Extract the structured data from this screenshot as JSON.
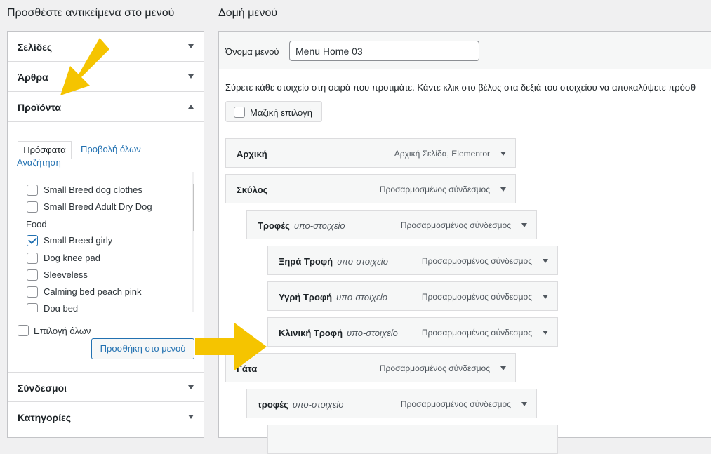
{
  "left": {
    "heading": "Προσθέστε αντικείμενα στο μενού",
    "sections_top": [
      {
        "label": "Σελίδες"
      },
      {
        "label": "Άρθρα"
      },
      {
        "label": "Προϊόντα"
      }
    ],
    "products": {
      "tabs": {
        "recent": "Πρόσφατα",
        "view_all": "Προβολή όλων",
        "search": "Αναζήτηση"
      },
      "items": [
        {
          "label": "Small Breed dog clothes",
          "checked": false
        },
        {
          "label": "Small Breed Adult Dry Dog",
          "checked": false
        },
        {
          "label": "Food",
          "continuation": true
        },
        {
          "label": "Small Breed girly",
          "checked": true
        },
        {
          "label": "Dog knee pad",
          "checked": false
        },
        {
          "label": "Sleeveless",
          "checked": false
        },
        {
          "label": "Calming bed peach pink",
          "checked": false
        },
        {
          "label": "Dog bed",
          "checked": false
        }
      ],
      "select_all": "Επιλογή όλων",
      "add_button": "Προσθήκη στο μενού"
    },
    "sections_bottom": [
      {
        "label": "Σύνδεσμοι"
      },
      {
        "label": "Κατηγορίες"
      }
    ]
  },
  "right": {
    "heading": "Δομή μενού",
    "menu_name_label": "Όνομα μενού",
    "menu_name_value": "Menu Home 03",
    "instructions": "Σύρετε κάθε στοιχείο στη σειρά που προτιμάτε. Κάντε κλικ στο βέλος στα δεξιά του στοιχείου να αποκαλύψετε πρόσθ",
    "bulk_select": "Μαζική επιλογή",
    "menu_items": [
      {
        "title": "Αρχική",
        "sub": "",
        "kind": "Αρχική Σελίδα, Elementor"
      },
      {
        "title": "Σκύλος",
        "sub": "",
        "kind": "Προσαρμοσμένος σύνδεσμος"
      },
      {
        "title": "Τροφές",
        "sub": "υπο-στοιχείο",
        "kind": "Προσαρμοσμένος σύνδεσμος"
      },
      {
        "title": "Ξηρά Τροφή",
        "sub": "υπο-στοιχείο",
        "kind": "Προσαρμοσμένος σύνδεσμος"
      },
      {
        "title": "Υγρή Τροφή",
        "sub": "υπο-στοιχείο",
        "kind": "Προσαρμοσμένος σύνδεσμος"
      },
      {
        "title": "Κλινική Τροφή",
        "sub": "υπο-στοιχείο",
        "kind": "Προσαρμοσμένος σύνδεσμος"
      },
      {
        "title": "Γάτα",
        "sub": "",
        "kind": "Προσαρμοσμένος σύνδεσμος"
      },
      {
        "title": "τροφές",
        "sub": "υπο-στοιχείο",
        "kind": "Προσαρμοσμένος σύνδεσμος"
      }
    ]
  },
  "colors": {
    "accent": "#2271b1",
    "annotation_arrow": "#f5c400"
  }
}
